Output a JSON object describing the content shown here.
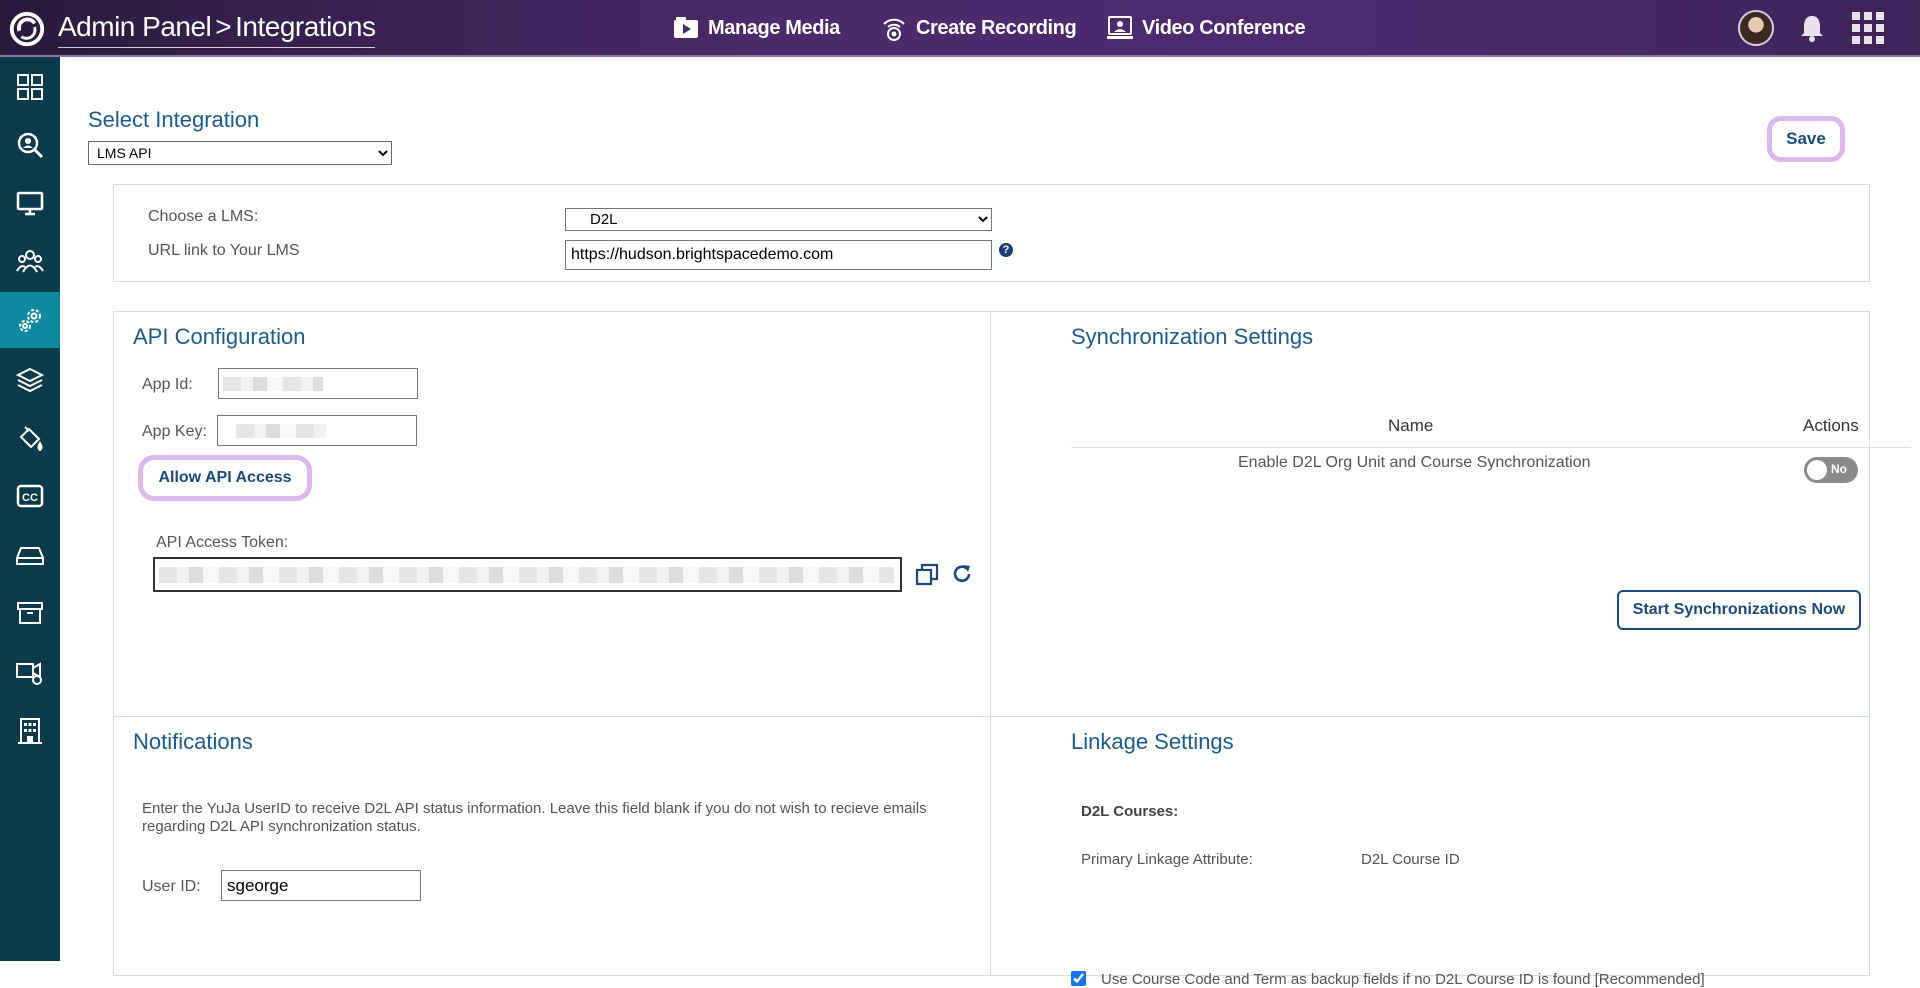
{
  "header": {
    "breadcrumb": [
      "Admin Panel",
      ">",
      "Integrations"
    ],
    "nav": [
      {
        "label": "Manage Media",
        "icon": "media-folder-icon"
      },
      {
        "label": "Create Recording",
        "icon": "recording-icon"
      },
      {
        "label": "Video Conference",
        "icon": "video-conference-icon"
      }
    ],
    "right_icons": [
      "avatar",
      "bell-icon",
      "apps-grid-icon"
    ]
  },
  "sidebar": {
    "items": [
      {
        "icon": "dashboard-icon",
        "active": false
      },
      {
        "icon": "search-icon",
        "active": false
      },
      {
        "icon": "monitor-icon",
        "active": false
      },
      {
        "icon": "users-icon",
        "active": false
      },
      {
        "icon": "settings-gears-icon",
        "active": true
      },
      {
        "icon": "layers-icon",
        "active": false
      },
      {
        "icon": "paint-bucket-icon",
        "active": false
      },
      {
        "icon": "closed-captions-icon",
        "active": false
      },
      {
        "icon": "storage-drive-icon",
        "active": false
      },
      {
        "icon": "archive-icon",
        "active": false
      },
      {
        "icon": "camera-settings-icon",
        "active": false
      },
      {
        "icon": "building-icon",
        "active": false
      }
    ]
  },
  "page": {
    "title": "Select Integration",
    "integration_value": "LMS API",
    "save_label": "Save"
  },
  "lms": {
    "choose_label": "Choose a LMS:",
    "choose_value": "D2L",
    "url_label": "URL link to Your LMS",
    "url_value": "https://hudson.brightspacedemo.com",
    "help_glyph": "?"
  },
  "api_config": {
    "heading": "API Configuration",
    "app_id_label": "App Id:",
    "app_key_label": "App Key:",
    "allow_label": "Allow API Access",
    "token_label": "API Access Token:"
  },
  "sync": {
    "heading": "Synchronization Settings",
    "col_name": "Name",
    "col_actions": "Actions",
    "row_name": "Enable D2L Org Unit and Course Synchronization",
    "toggle_label": "No",
    "start_label": "Start Synchronizations Now"
  },
  "notifications": {
    "heading": "Notifications",
    "description": "Enter the YuJa UserID to receive D2L API status information. Leave this field blank if you do not wish to recieve emails regarding D2L API synchronization status.",
    "user_label": "User ID:",
    "user_value": "sgeorge"
  },
  "linkage": {
    "heading": "Linkage Settings",
    "courses_label": "D2L Courses:",
    "primary_label": "Primary Linkage Attribute:",
    "primary_value": "D2L Course ID",
    "backup_label": "Use Course Code and Term as backup fields if no D2L Course ID is found [Recommended]",
    "backup_checked": true
  }
}
